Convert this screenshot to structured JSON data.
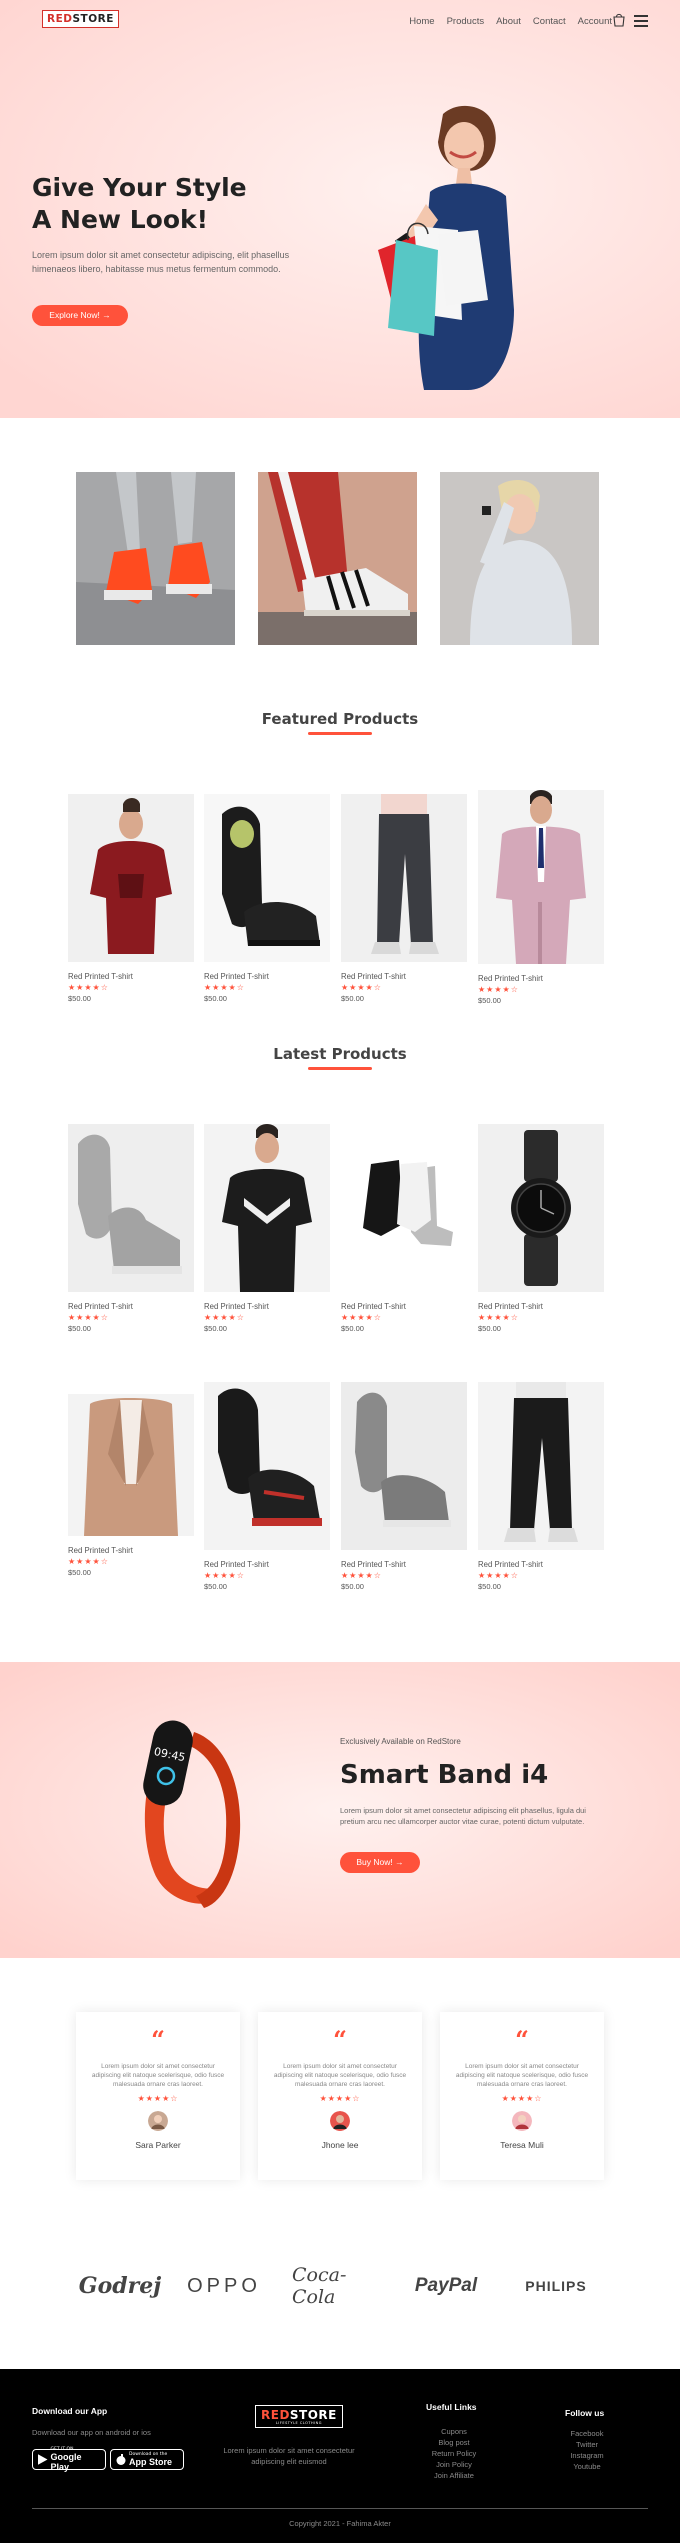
{
  "nav": {
    "logo_red": "RED",
    "logo_dark": "STORE",
    "links": [
      "Home",
      "Products",
      "About",
      "Contact",
      "Account"
    ]
  },
  "hero": {
    "title_line1": "Give Your Style",
    "title_line2": "A New Look!",
    "text": "Lorem ipsum dolor sit amet consectetur adipiscing, elit phasellus himenaeos libero, habitasse mus metus fermentum commodo.",
    "button": "Explore Now! →"
  },
  "featured": {
    "title": "Featured Products",
    "products": [
      {
        "name": "Red Printed T-shirt",
        "stars": "★★★★☆",
        "price": "$50.00"
      },
      {
        "name": "Red Printed T-shirt",
        "stars": "★★★★☆",
        "price": "$50.00"
      },
      {
        "name": "Red Printed T-shirt",
        "stars": "★★★★☆",
        "price": "$50.00"
      },
      {
        "name": "Red Printed T-shirt",
        "stars": "★★★★☆",
        "price": "$50.00"
      }
    ]
  },
  "latest": {
    "title": "Latest Products",
    "products": [
      {
        "name": "Red Printed T-shirt",
        "stars": "★★★★☆",
        "price": "$50.00"
      },
      {
        "name": "Red Printed T-shirt",
        "stars": "★★★★☆",
        "price": "$50.00"
      },
      {
        "name": "Red Printed T-shirt",
        "stars": "★★★★☆",
        "price": "$50.00"
      },
      {
        "name": "Red Printed T-shirt",
        "stars": "★★★★☆",
        "price": "$50.00"
      },
      {
        "name": "Red Printed T-shirt",
        "stars": "★★★★☆",
        "price": "$50.00"
      },
      {
        "name": "Red Printed T-shirt",
        "stars": "★★★★☆",
        "price": "$50.00"
      },
      {
        "name": "Red Printed T-shirt",
        "stars": "★★★★☆",
        "price": "$50.00"
      },
      {
        "name": "Red Printed T-shirt",
        "stars": "★★★★☆",
        "price": "$50.00"
      }
    ]
  },
  "offer": {
    "small": "Exclusively Available on RedStore",
    "title": "Smart Band i4",
    "text": "Lorem ipsum dolor sit amet consectetur adipiscing elit phasellus, ligula dui pretium arcu nec ullamcorper auctor vitae curae, potenti dictum vulputate.",
    "button": "Buy Now! →"
  },
  "testimonials": [
    {
      "quote": "“",
      "text": "Lorem ipsum dolor sit amet consectetur adipiscing elit natoque scelerisque, odio fusce malesuada ornare cras laoreet.",
      "stars": "★★★★☆",
      "name": "Sara Parker"
    },
    {
      "quote": "“",
      "text": "Lorem ipsum dolor sit amet consectetur adipiscing elit natoque scelerisque, odio fusce malesuada ornare cras laoreet.",
      "stars": "★★★★☆",
      "name": "Jhone lee"
    },
    {
      "quote": "“",
      "text": "Lorem ipsum dolor sit amet consectetur adipiscing elit natoque scelerisque, odio fusce malesuada ornare cras laoreet.",
      "stars": "★★★★☆",
      "name": "Teresa Muli"
    }
  ],
  "brands": [
    "Godrej",
    "OPPO",
    "Coca-Cola",
    "PayPal",
    "PHILIPS"
  ],
  "footer": {
    "download_title": "Download our App",
    "download_text": "Download our app on android or ios",
    "google_small": "GET IT ON",
    "google_label": "Google Play",
    "apple_small": "Download on the",
    "apple_label": "App Store",
    "logo_red": "RED",
    "logo_white": "STORE",
    "logo_sub": "LIFESTYLE CLOTHING",
    "about_text": "Lorem ipsum dolor sit amet consectetur adipiscing elit euismod",
    "links_title": "Useful Links",
    "links": [
      "Cupons",
      "Blog post",
      "Return Policy",
      "Join Policy",
      "Join Affiliate"
    ],
    "follow_title": "Follow us",
    "follow": [
      "Facebook",
      "Twitter",
      "Instagram",
      "Youtube"
    ],
    "copyright": "Copyright 2021 - Fahima Akter"
  }
}
